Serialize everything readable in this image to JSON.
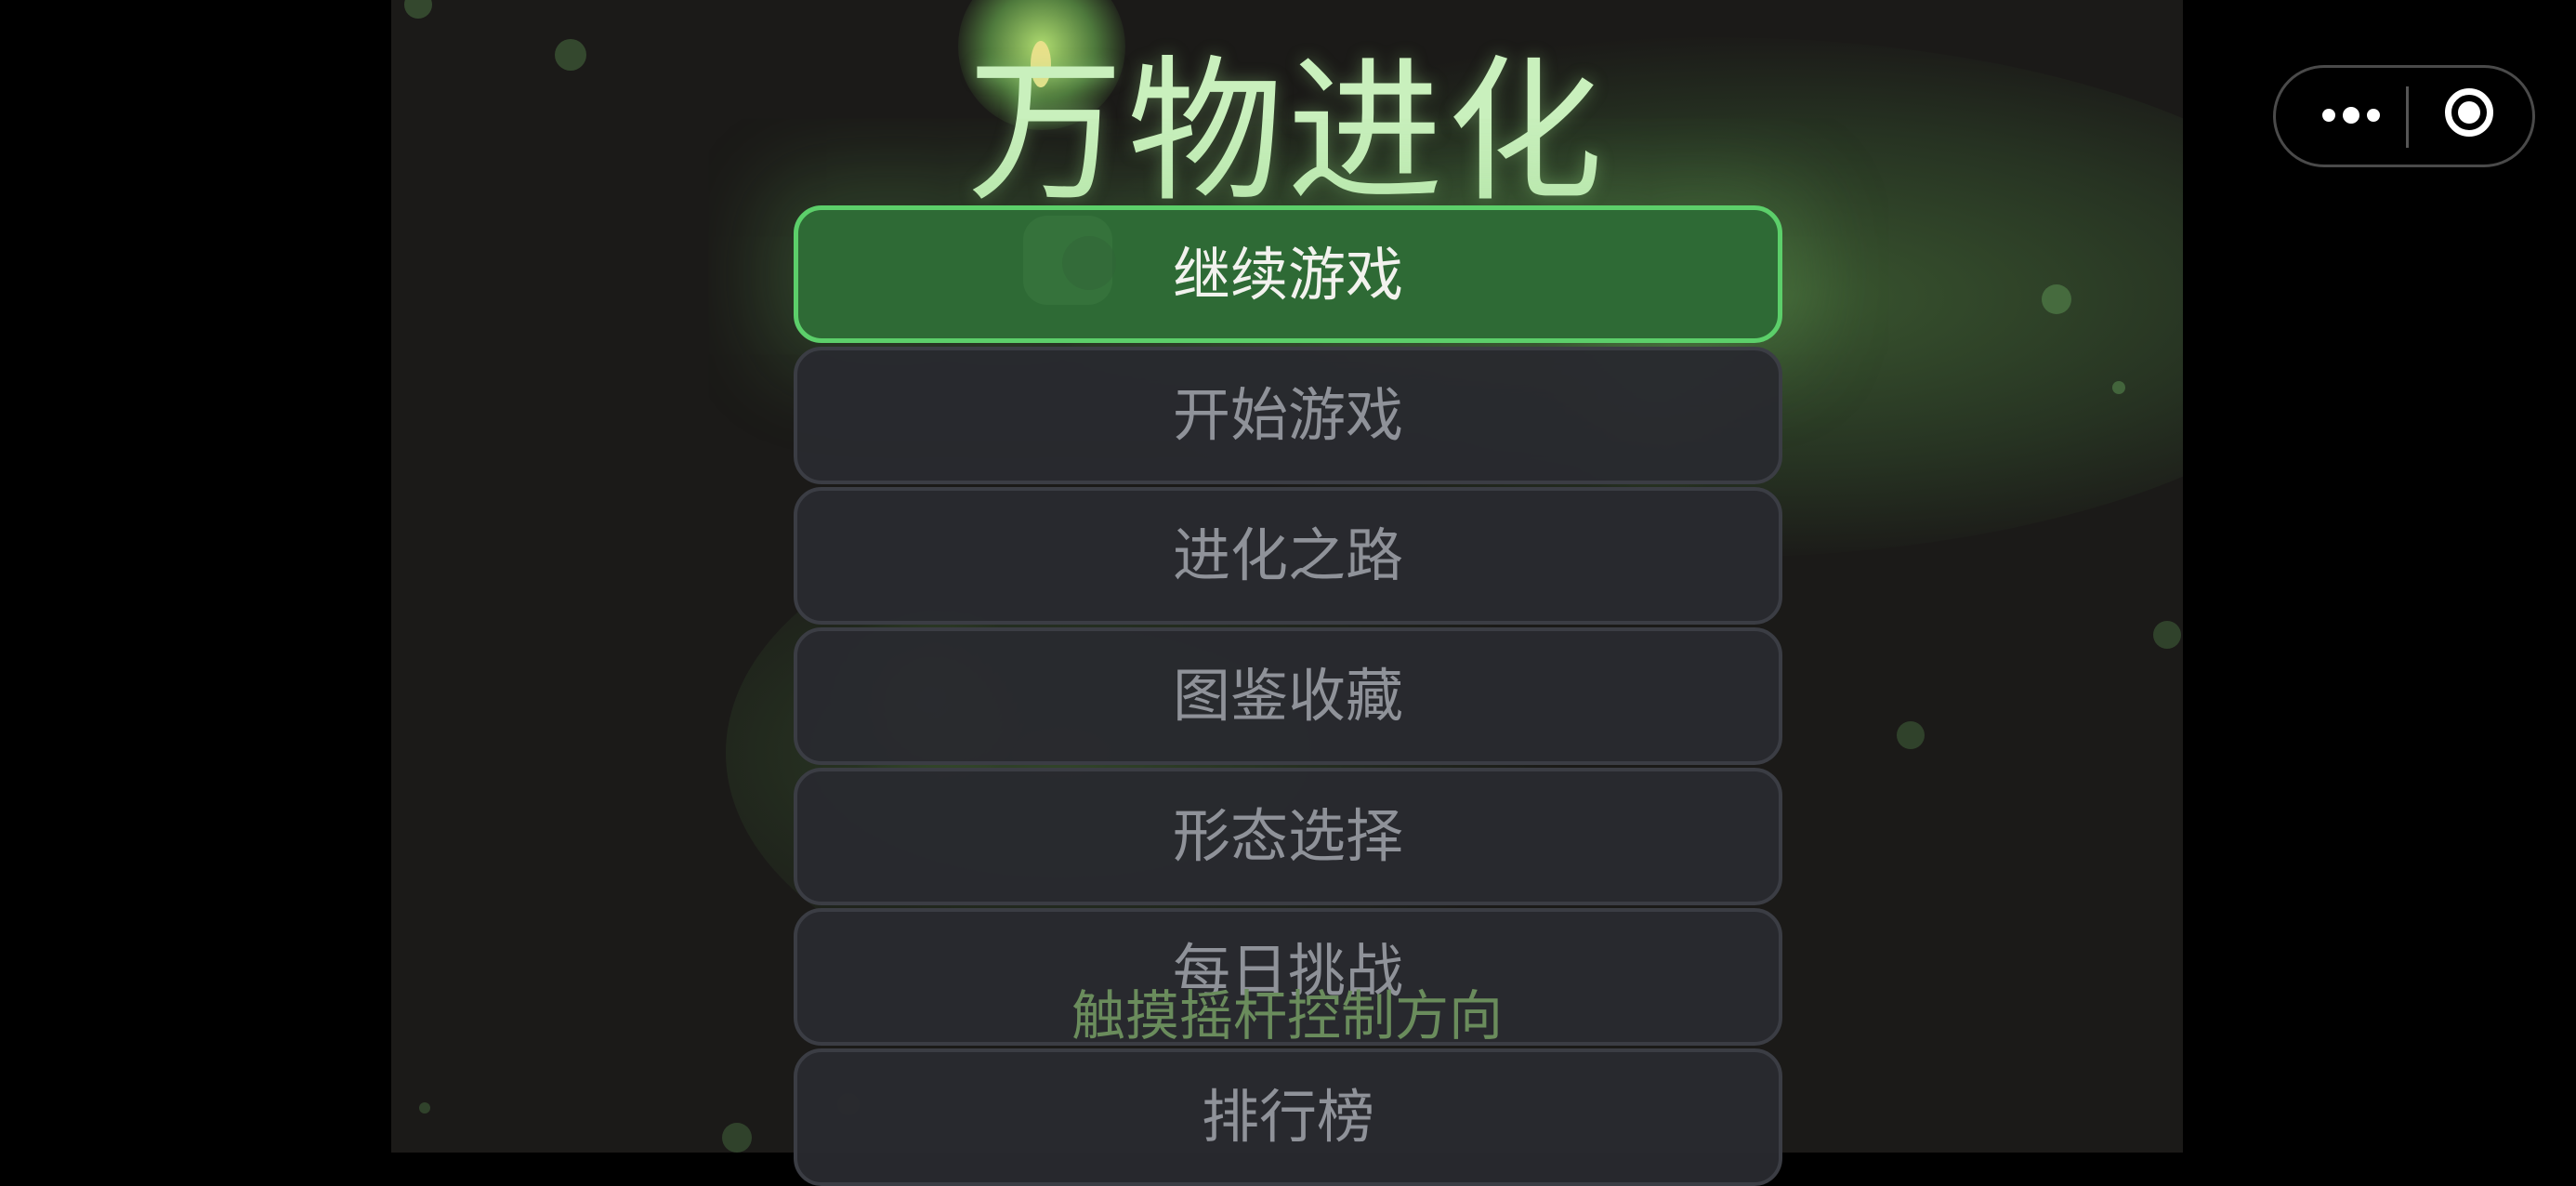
{
  "game": {
    "title": "万物进化",
    "hint": "触摸摇杆控制方向"
  },
  "menu": {
    "items": [
      {
        "label": "继续游戏",
        "primary": true
      },
      {
        "label": "开始游戏"
      },
      {
        "label": "进化之路"
      },
      {
        "label": "图鉴收藏"
      },
      {
        "label": "形态选择"
      },
      {
        "label": "每日挑战"
      },
      {
        "label": "排行榜"
      }
    ]
  },
  "capsule": {
    "more_icon": "more-dots-icon",
    "close_icon": "target-close-icon"
  },
  "colors": {
    "primary_button": "#2e6a35",
    "primary_border": "#5ccf6a",
    "title": "#c9f0bd",
    "background": "#1b1a18"
  }
}
